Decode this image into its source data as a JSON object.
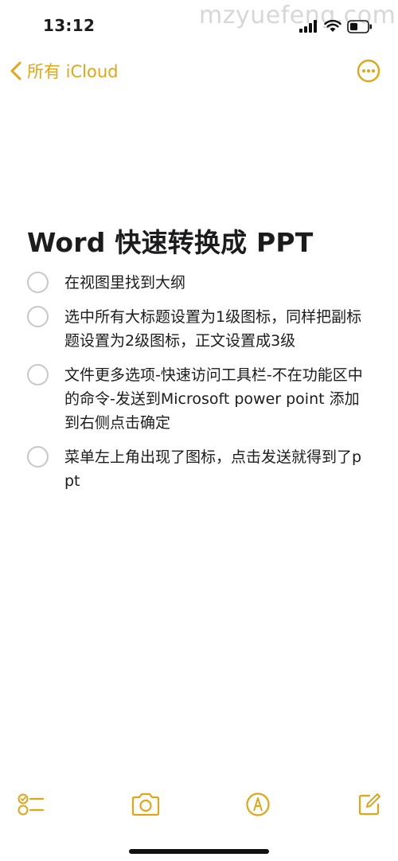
{
  "status": {
    "time": "13:12"
  },
  "watermark": "mzyuefeng.com",
  "nav": {
    "back_label": "所有 iCloud"
  },
  "note": {
    "title": "Word 快速转换成 PPT",
    "items": [
      {
        "text": "在视图里找到大纲",
        "checked": false
      },
      {
        "text": "选中所有大标题设置为1级图标，同样把副标题设置为2级图标，正文设置成3级",
        "checked": false
      },
      {
        "text": "文件更多选项-快速访问工具栏-不在功能区中的命令-发送到Microsoft power point 添加到右侧点击确定",
        "checked": false
      },
      {
        "text": "菜单左上角出现了图标，点击发送就得到了ppt",
        "checked": false
      }
    ]
  },
  "colors": {
    "accent": "#e0a617",
    "checkbox": "#c7c7cc",
    "text": "#1c1c1e"
  },
  "icons": {
    "nav": [
      "chevron-left-icon",
      "more-options-icon"
    ],
    "toolbar": [
      "checklist-icon",
      "camera-icon",
      "markup-icon",
      "compose-icon"
    ]
  }
}
